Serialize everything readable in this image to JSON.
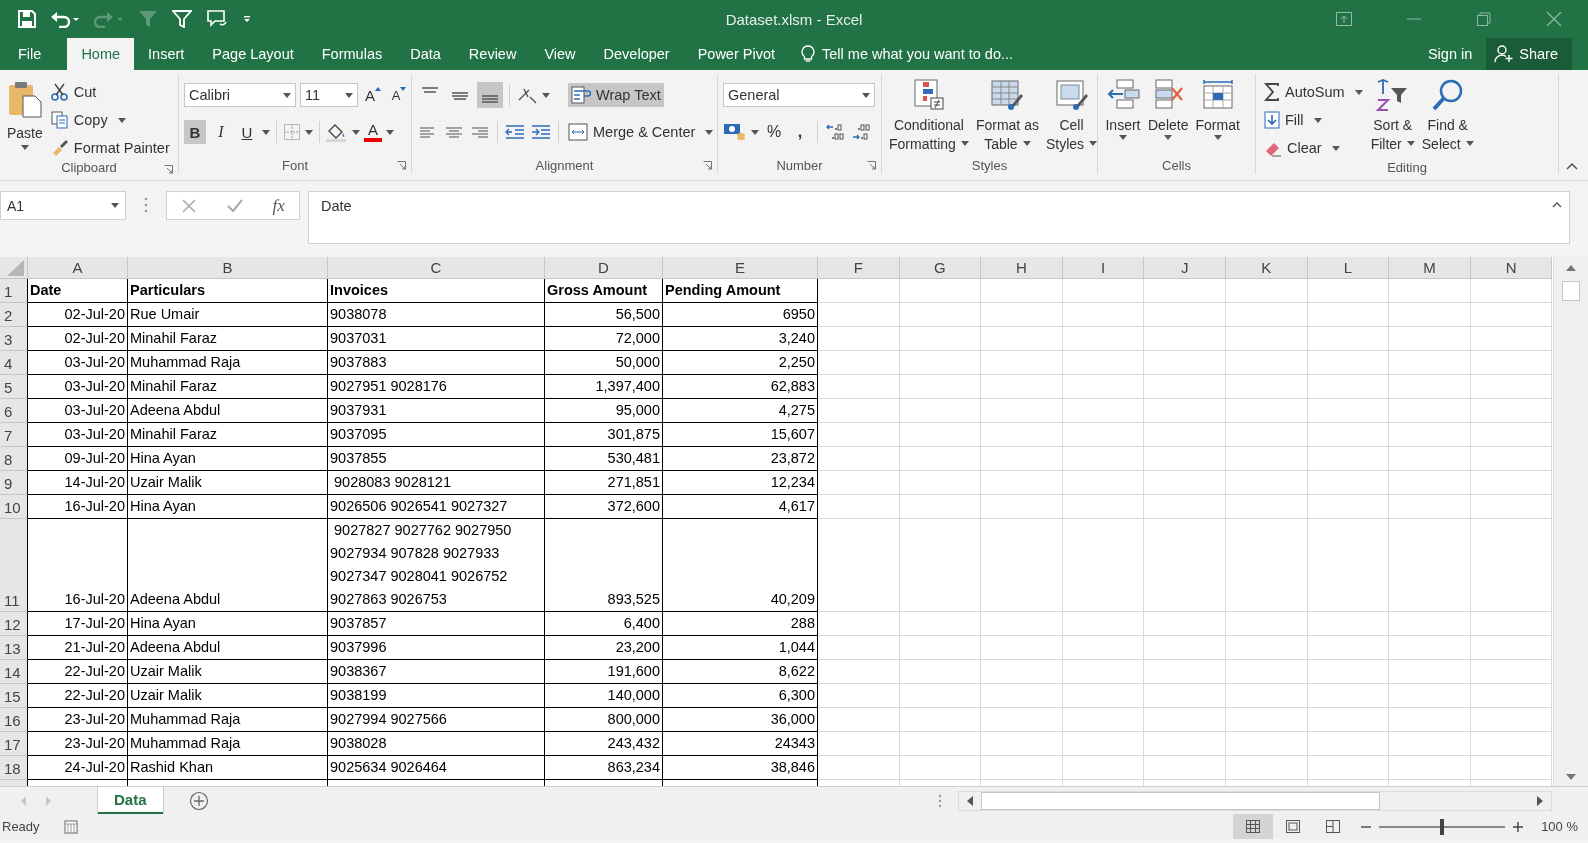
{
  "window": {
    "title": "Dataset.xlsm - Excel"
  },
  "ribbon_tabs": [
    {
      "label": "File",
      "selected": false
    },
    {
      "label": "Home",
      "selected": true
    },
    {
      "label": "Insert",
      "selected": false
    },
    {
      "label": "Page Layout",
      "selected": false
    },
    {
      "label": "Formulas",
      "selected": false
    },
    {
      "label": "Data",
      "selected": false
    },
    {
      "label": "Review",
      "selected": false
    },
    {
      "label": "View",
      "selected": false
    },
    {
      "label": "Developer",
      "selected": false
    },
    {
      "label": "Power Pivot",
      "selected": false
    }
  ],
  "tell_me": {
    "placeholder": "Tell me what you want to do..."
  },
  "sign_in": "Sign in",
  "share": "Share",
  "clipboard": {
    "label": "Clipboard",
    "paste": "Paste",
    "cut": "Cut",
    "copy": "Copy",
    "format_painter": "Format Painter"
  },
  "font": {
    "label": "Font",
    "name": "Calibri",
    "size": "11",
    "grow": "A",
    "shrink": "A",
    "bold": {
      "text": "B",
      "on": true
    },
    "italic": {
      "text": "I",
      "on": false
    },
    "underline": {
      "text": "U",
      "on": false
    },
    "color_label": "A"
  },
  "alignment": {
    "label": "Alignment",
    "vertical": [
      {
        "selected": false
      },
      {
        "selected": false
      },
      {
        "selected": true
      }
    ],
    "wrap_text": {
      "text": "Wrap Text",
      "on": true
    },
    "merge": "Merge & Center"
  },
  "number": {
    "label": "Number",
    "format": "General",
    "percent": "%",
    "comma": ","
  },
  "styles": {
    "label": "Styles",
    "buttons": [
      {
        "lines": [
          "Conditional",
          "Formatting"
        ]
      },
      {
        "lines": [
          "Format as",
          "Table"
        ]
      },
      {
        "lines": [
          "Cell",
          "Styles"
        ]
      }
    ]
  },
  "cells": {
    "label": "Cells",
    "buttons": [
      "Insert",
      "Delete",
      "Format"
    ]
  },
  "editing": {
    "label": "Editing",
    "autosum": "AutoSum",
    "fill": "Fill",
    "clear": "Clear",
    "buttons": [
      {
        "lines": [
          "Sort &",
          "Filter"
        ]
      },
      {
        "lines": [
          "Find &",
          "Select"
        ]
      }
    ]
  },
  "formula_bar": {
    "name_box": "A1",
    "function_label": "fx",
    "value": "Date"
  },
  "columns": [
    "A",
    "B",
    "C",
    "D",
    "E",
    "F",
    "G",
    "H",
    "I",
    "J",
    "K",
    "L",
    "M",
    "N"
  ],
  "rows": [
    {
      "number": "1",
      "cells": [
        "Date",
        "Particulars",
        "Invoices",
        "Gross Amount",
        "Pending Amount"
      ]
    },
    {
      "number": "2",
      "cells": [
        "02-Jul-20",
        "Rue Umair",
        "9038078",
        "56,500",
        "6950"
      ]
    },
    {
      "number": "3",
      "cells": [
        "02-Jul-20",
        "Minahil Faraz",
        "9037031",
        "72,000",
        "3,240"
      ]
    },
    {
      "number": "4",
      "cells": [
        "03-Jul-20",
        "Muhammad Raja",
        "9037883",
        "50,000",
        "2,250"
      ]
    },
    {
      "number": "5",
      "cells": [
        "03-Jul-20",
        "Minahil Faraz",
        "9027951 9028176",
        "1,397,400",
        "62,883"
      ]
    },
    {
      "number": "6",
      "cells": [
        "03-Jul-20",
        "Adeena Abdul",
        "9037931",
        "95,000",
        "4,275"
      ]
    },
    {
      "number": "7",
      "cells": [
        "03-Jul-20",
        "Minahil Faraz",
        "9037095",
        "301,875",
        "15,607"
      ]
    },
    {
      "number": "8",
      "cells": [
        "09-Jul-20",
        "Hina Ayan",
        "9037855",
        "530,481",
        "23,872"
      ]
    },
    {
      "number": "9",
      "cells": [
        "14-Jul-20",
        "Uzair Malik",
        " 9028083 9028121",
        "271,851",
        "12,234"
      ]
    },
    {
      "number": "10",
      "cells": [
        "16-Jul-20",
        "Hina Ayan",
        "9026506 9026541 9027327",
        "372,600",
        "4,617"
      ]
    },
    {
      "number": "11",
      "cells": [
        "16-Jul-20",
        "Adeena Abdul",
        " 9027827 9027762 9027950 9027934 907828 9027933 9027347 9028041 9026752 9027863 9026753",
        "893,525",
        "40,209"
      ]
    },
    {
      "number": "12",
      "cells": [
        "17-Jul-20",
        "Hina Ayan",
        "9037857",
        "6,400",
        "288"
      ]
    },
    {
      "number": "13",
      "cells": [
        "21-Jul-20",
        "Adeena Abdul",
        "9037996",
        "23,200",
        "1,044"
      ]
    },
    {
      "number": "14",
      "cells": [
        "22-Jul-20",
        "Uzair Malik",
        "9038367",
        "191,600",
        "8,622"
      ]
    },
    {
      "number": "15",
      "cells": [
        "22-Jul-20",
        "Uzair Malik",
        "9038199",
        "140,000",
        "6,300"
      ]
    },
    {
      "number": "16",
      "cells": [
        "23-Jul-20",
        "Muhammad Raja",
        "9027994 9027566",
        "800,000",
        "36,000"
      ]
    },
    {
      "number": "17",
      "cells": [
        "23-Jul-20",
        "Muhammad Raja",
        "9038028",
        "243,432",
        "24343"
      ]
    },
    {
      "number": "18",
      "cells": [
        "24-Jul-20",
        "Rashid Khan",
        "9025634 9026464",
        "863,234",
        "38,846"
      ]
    }
  ],
  "sheet_tabs": [
    {
      "label": "Data",
      "selected": true
    }
  ],
  "status_bar": {
    "status": "Ready",
    "views": [
      {
        "selected": true
      },
      {
        "selected": false
      },
      {
        "selected": false
      }
    ],
    "zoom": "100 %",
    "zoom_slider": {
      "level": 0.5
    }
  }
}
